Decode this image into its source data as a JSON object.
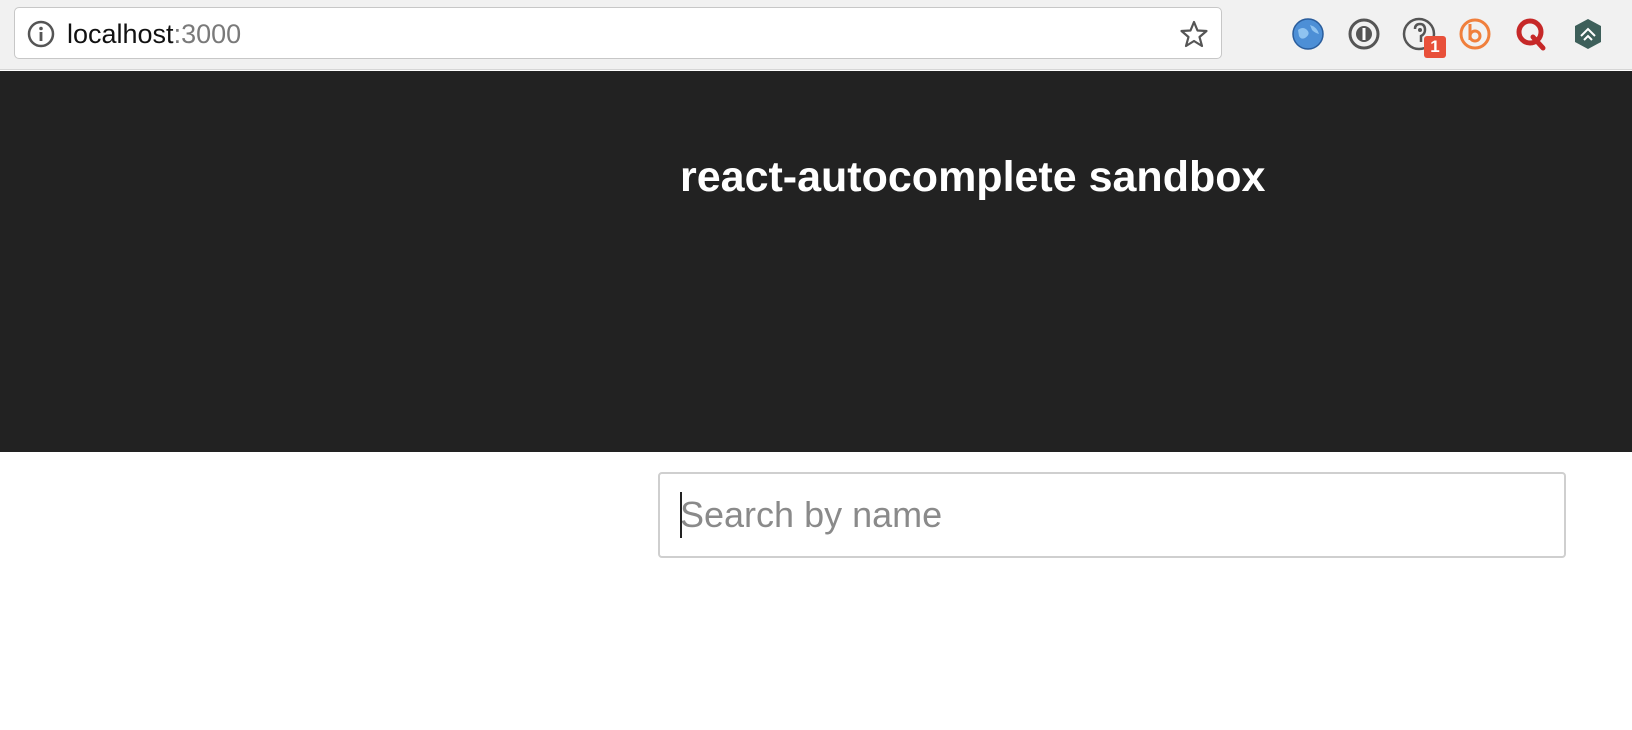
{
  "browser": {
    "url_host": "localhost",
    "url_port": ":3000",
    "extensions": [
      {
        "name": "globe-extension-icon"
      },
      {
        "name": "password-manager-icon"
      },
      {
        "name": "listening-ear-icon"
      },
      {
        "name": "b-extension-icon"
      },
      {
        "name": "q-extension-icon"
      },
      {
        "name": "shield-extension-icon"
      }
    ],
    "badge_count": "1"
  },
  "hero": {
    "title": "react-autocomplete sandbox"
  },
  "search": {
    "placeholder": "Search by name",
    "value": ""
  },
  "colors": {
    "hero_bg": "#222222",
    "badge": "#e8503a",
    "b_extension": "#f07f3c",
    "q_extension": "#c62828"
  }
}
